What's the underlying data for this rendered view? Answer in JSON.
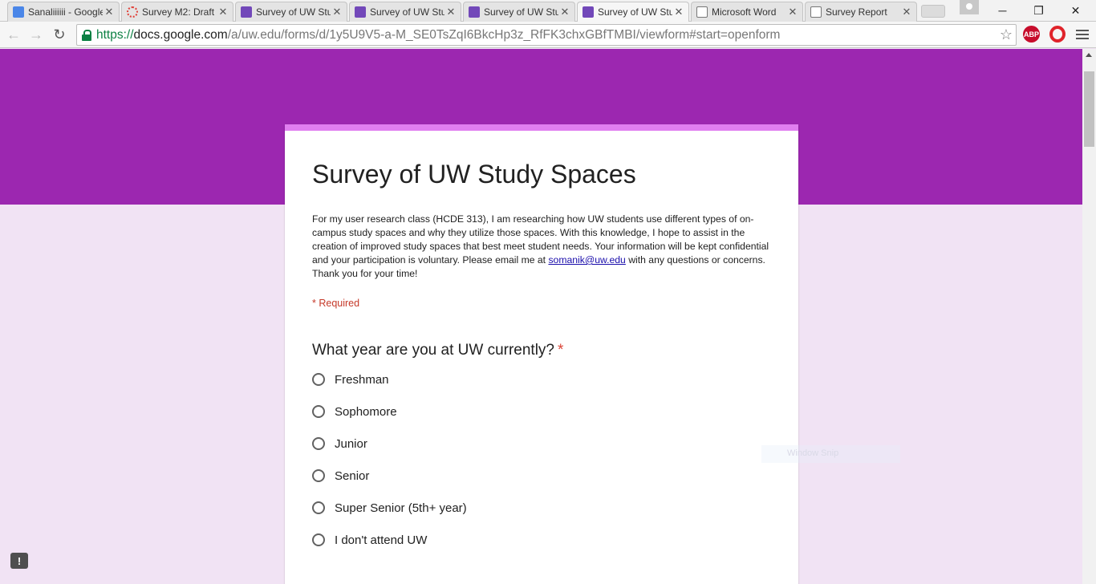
{
  "browser": {
    "tabs": [
      {
        "label": "Sanaliiiiii - Google",
        "icon": "docs-icon"
      },
      {
        "label": "Survey M2: Draft",
        "icon": "loading-icon"
      },
      {
        "label": "Survey of UW Study",
        "icon": "forms-icon"
      },
      {
        "label": "Survey of UW Study",
        "icon": "forms-icon"
      },
      {
        "label": "Survey of UW Study",
        "icon": "forms-icon"
      },
      {
        "label": "Survey of UW Study",
        "icon": "forms-icon",
        "active": true
      },
      {
        "label": "Microsoft Word",
        "icon": "page-icon"
      },
      {
        "label": "Survey Report",
        "icon": "page-icon"
      }
    ],
    "window_controls": {
      "minimize": "─",
      "restore": "❐",
      "close": "✕"
    },
    "url": {
      "scheme": "https://",
      "host": "docs.google.com",
      "path": "/a/uw.edu/forms/d/1y5U9V5-a-M_SE0TsZqI6BkcHp3z_RfFK3chxGBfTMBI/viewform#start=openform"
    },
    "extensions": {
      "abp": "ABP"
    }
  },
  "form": {
    "theme_color": "#9c27b0",
    "accent_color": "#e07ef0",
    "title": "Survey of UW Study Spaces",
    "description_before_link": "For my user research class (HCDE 313), I am researching how UW students use different types of on-campus study spaces and why they utilize those spaces. With this knowledge, I hope to assist in the creation of improved study spaces that best meet student needs. Your information will be kept confidential and your participation is voluntary. Please email me at ",
    "description_link": "somanik@uw.edu",
    "description_after_link": " with any questions or concerns. Thank you for your time!",
    "required_note": "* Required",
    "question": {
      "title": "What year are you at UW currently?",
      "required_marker": "*",
      "options": [
        "Freshman",
        "Sophomore",
        "Junior",
        "Senior",
        "Super Senior (5th+ year)",
        "I don't attend UW"
      ]
    }
  },
  "overlay": {
    "snip_text": "Window Snip",
    "feedback_icon": "!"
  }
}
